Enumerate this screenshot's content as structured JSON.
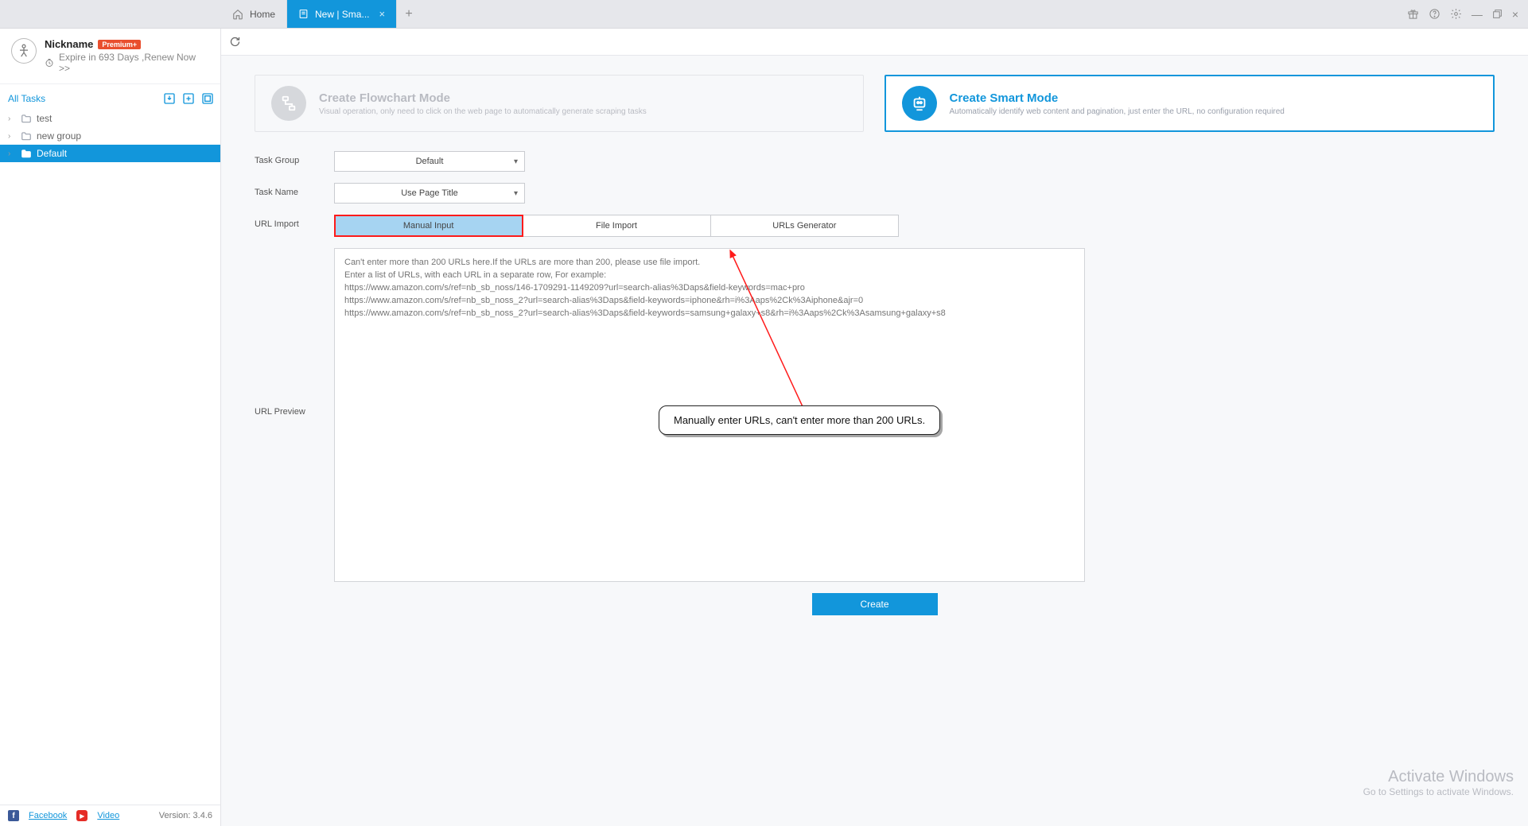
{
  "titlebar": {
    "tabs": [
      {
        "label": "Home",
        "active": false
      },
      {
        "label": "New | Sma...",
        "active": true
      }
    ]
  },
  "sidebar": {
    "nickname": "Nickname",
    "premium_badge": "Premium+",
    "expire_text": "Expire in 693 Days ,Renew Now >>",
    "all_tasks_label": "All Tasks",
    "tree": [
      {
        "label": "test",
        "selected": false
      },
      {
        "label": "new group",
        "selected": false
      },
      {
        "label": "Default",
        "selected": true
      }
    ],
    "facebook_label": "Facebook",
    "video_label": "Video",
    "version_label": "Version: 3.4.6"
  },
  "modes": {
    "flowchart": {
      "title": "Create Flowchart Mode",
      "subtitle": "Visual operation, only need to click on the web page to automatically generate scraping tasks"
    },
    "smart": {
      "title": "Create Smart Mode",
      "subtitle": "Automatically identify web content and pagination, just enter the URL, no configuration required"
    }
  },
  "form": {
    "task_group_label": "Task Group",
    "task_group_value": "Default",
    "task_name_label": "Task Name",
    "task_name_value": "Use Page Title",
    "url_import_label": "URL Import",
    "url_preview_label": "URL Preview",
    "import_tabs": {
      "manual": "Manual Input",
      "file": "File Import",
      "generator": "URLs Generator"
    },
    "textarea_placeholder": "Can't enter more than 200 URLs here.If the URLs are more than 200, please use file import.\nEnter a list of URLs, with each URL in a separate row, For example:\nhttps://www.amazon.com/s/ref=nb_sb_noss/146-1709291-1149209?url=search-alias%3Daps&field-keywords=mac+pro\nhttps://www.amazon.com/s/ref=nb_sb_noss_2?url=search-alias%3Daps&field-keywords=iphone&rh=i%3Aaps%2Ck%3Aiphone&ajr=0\nhttps://www.amazon.com/s/ref=nb_sb_noss_2?url=search-alias%3Daps&field-keywords=samsung+galaxy+s8&rh=i%3Aaps%2Ck%3Asamsung+galaxy+s8",
    "create_button": "Create"
  },
  "annotation": {
    "callout_text": "Manually enter URLs, can't enter more than 200 URLs."
  },
  "watermark": {
    "line1": "Activate Windows",
    "line2": "Go to Settings to activate Windows."
  }
}
